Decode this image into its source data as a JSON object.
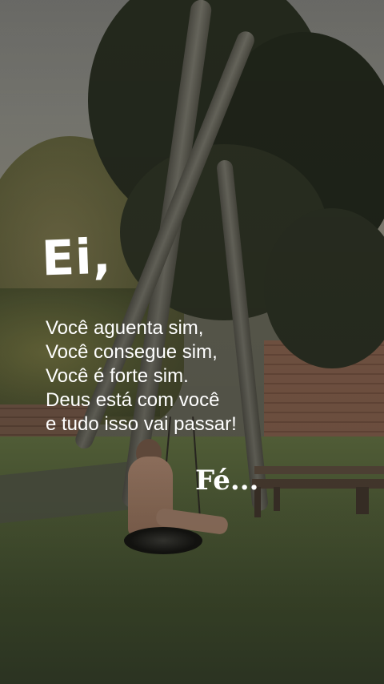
{
  "overlay": {
    "greeting": "Ei,",
    "lines": [
      "Você aguenta sim,",
      "Você consegue sim,",
      "Você é forte sim.",
      "Deus está com você",
      "e tudo isso vai passar!"
    ],
    "signoff": "Fé..."
  },
  "colors": {
    "text": "#ffffff",
    "foliage": "#252a1e",
    "grass": "#4f5c37",
    "brick": "#7c5a48"
  }
}
